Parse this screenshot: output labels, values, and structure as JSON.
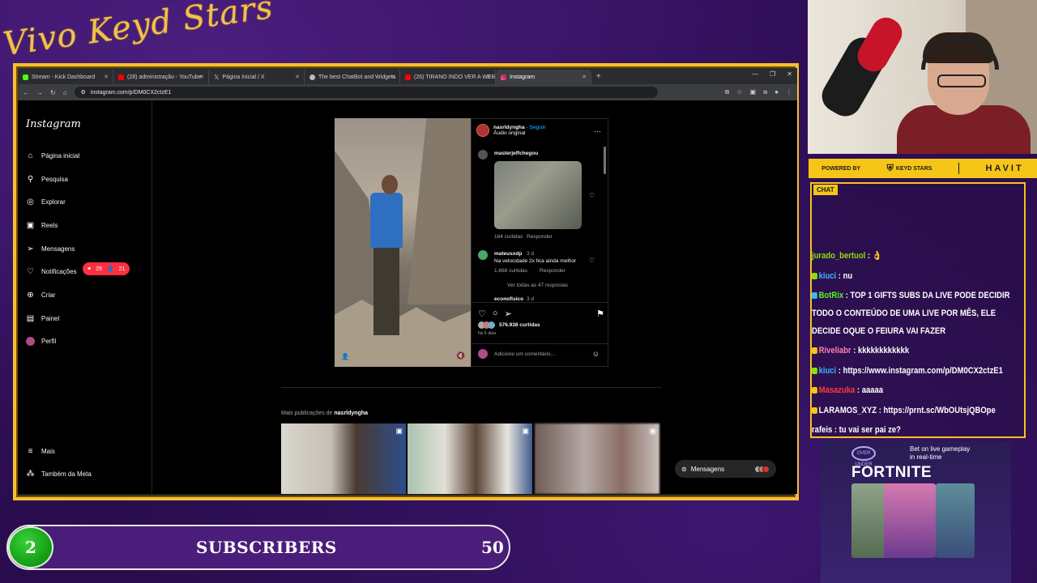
{
  "overlay": {
    "brand_script": "Vivo Keyd Stars",
    "accent": "#f2c12e"
  },
  "browser": {
    "tabs": [
      {
        "title": "Stream - Kick Dashboard",
        "favicon": "kick",
        "active": false
      },
      {
        "title": "(28) administração - YouTube",
        "favicon": "youtube",
        "active": false
      },
      {
        "title": "Página Inicial / X",
        "favicon": "x",
        "active": false
      },
      {
        "title": "The best ChatBot and Widgets",
        "favicon": "botrix",
        "active": false
      },
      {
        "title": "(26) TIRANO INDO VER A WEB",
        "favicon": "youtube",
        "active": false
      },
      {
        "title": "Instagram",
        "favicon": "instagram",
        "active": true
      }
    ],
    "url": "instagram.com/p/DM0CX2ctzE1"
  },
  "instagram": {
    "logo": "Instagram",
    "nav": [
      {
        "label": "Página inicial",
        "icon": "home-icon"
      },
      {
        "label": "Pesquisa",
        "icon": "search-icon"
      },
      {
        "label": "Explorar",
        "icon": "compass-icon"
      },
      {
        "label": "Reels",
        "icon": "reels-icon"
      },
      {
        "label": "Mensagens",
        "icon": "send-icon"
      },
      {
        "label": "Notificações",
        "icon": "heart-icon"
      },
      {
        "label": "Criar",
        "icon": "plus-icon"
      },
      {
        "label": "Painel",
        "icon": "chart-icon"
      },
      {
        "label": "Perfil",
        "icon": "avatar-icon"
      }
    ],
    "nav_bottom": [
      {
        "label": "Mais",
        "icon": "menu-icon"
      },
      {
        "label": "Também da Meta",
        "icon": "meta-icon"
      }
    ],
    "notifications": {
      "likes": "29",
      "follows": "21"
    },
    "post": {
      "username": "nasrldyngha",
      "follow": "Seguir",
      "audio": "Áudio original",
      "comments": [
        {
          "user": "masterjeffchegou",
          "text": "",
          "likes": "164 curtidas",
          "reply": "Responder"
        },
        {
          "user": "mateusxdp",
          "time": "3 d",
          "text": "Na velocidade 2x fica ainda melhor",
          "likes": "1.668 curtidas",
          "reply": "Responder",
          "view_replies": "Ver todas as 47 respostas"
        },
        {
          "user": "econofisico",
          "time": "3 d",
          "text": ""
        }
      ],
      "likes": "576.938 curtidas",
      "age": "há 6 dias",
      "comment_placeholder": "Adicione um comentário..."
    },
    "more_posts_prefix": "Mais publicações de",
    "more_posts_user": "nasrldyngha",
    "messages_label": "Mensagens"
  },
  "sponsor": {
    "powered_by": "POWERED BY",
    "keyd": "KEYD STARS",
    "havit": "HAVIT"
  },
  "chat": {
    "label": "CHAT",
    "messages": [
      {
        "user": "jurado_bertuol",
        "user_color": "#8fe000",
        "text": "👌",
        "badge": ""
      },
      {
        "user": "kiuci",
        "user_color": "#3bb4ff",
        "text": "nu",
        "badge": "#8fe000"
      },
      {
        "user": "BotRix",
        "user_color": "#53fc18",
        "text": "TOP 1 GIFTS SUBS DA LIVE PODE DECIDIR TODO O CONTEÚDO DE UMA LIVE POR MÊS, ELE DECIDE OQUE O FEIURA VAI FAZER",
        "badge": "#3bb4ff"
      },
      {
        "user": "Riveliabr",
        "user_color": "#ff7fb0",
        "text": "kkkkkkkkkkkk",
        "badge": "#f5c518"
      },
      {
        "user": "kiuci",
        "user_color": "#3bb4ff",
        "text": "https://www.instagram.com/p/DM0CX2ctzE1",
        "badge": "#8fe000"
      },
      {
        "user": "Masazuka",
        "user_color": "#ff3b3b",
        "text": "aaaaa",
        "badge": "#f5c518"
      },
      {
        "user": "LARAMOS_XYZ",
        "user_color": "#ffffff",
        "text": "https://prnt.sc/WbOUtsjQBOpe",
        "badge": "#f5c518"
      },
      {
        "user": "rafeis",
        "user_color": "#ffffff",
        "text": "tu vai ser pai ze?",
        "badge": ""
      }
    ]
  },
  "ad": {
    "brand": "OVER UNDER",
    "tagline_1": "Bet on live gameplay",
    "tagline_2": "in real-time",
    "title": "FORTNITE"
  },
  "subs": {
    "current": "2",
    "label": "SUBSCRIBERS",
    "goal": "50",
    "progress": 0.04
  }
}
